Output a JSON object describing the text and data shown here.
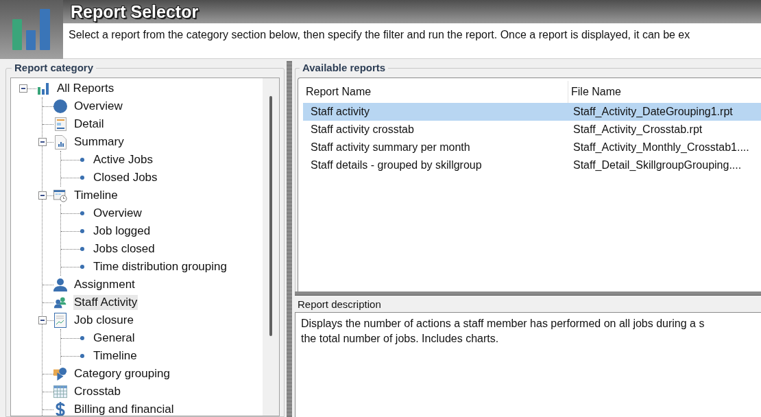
{
  "header": {
    "title": "Report Selector",
    "subtitle": "Select a report from the category section below, then specify the filter and run the report.  Once a report is displayed, it can be ex"
  },
  "category_panel": {
    "label": "Report category",
    "tree": [
      {
        "label": "All Reports",
        "kind": "all",
        "selected": false,
        "expanded": true,
        "children": [
          {
            "label": "Overview",
            "kind": "overview",
            "selected": false
          },
          {
            "label": "Detail",
            "kind": "detail",
            "selected": false
          },
          {
            "label": "Summary",
            "kind": "summary",
            "selected": false,
            "expanded": true,
            "children": [
              {
                "label": "Active Jobs",
                "kind": "leaf",
                "selected": false
              },
              {
                "label": "Closed Jobs",
                "kind": "leaf",
                "selected": false
              }
            ]
          },
          {
            "label": "Timeline",
            "kind": "timeline",
            "selected": false,
            "expanded": true,
            "children": [
              {
                "label": "Overview",
                "kind": "leaf",
                "selected": false
              },
              {
                "label": "Job logged",
                "kind": "leaf",
                "selected": false
              },
              {
                "label": "Jobs closed",
                "kind": "leaf",
                "selected": false
              },
              {
                "label": "Time distribution grouping",
                "kind": "leaf",
                "selected": false
              }
            ]
          },
          {
            "label": "Assignment",
            "kind": "assignment",
            "selected": false
          },
          {
            "label": "Staff Activity",
            "kind": "staff",
            "selected": true
          },
          {
            "label": "Job closure",
            "kind": "closure",
            "selected": false,
            "expanded": true,
            "children": [
              {
                "label": "General",
                "kind": "leaf",
                "selected": false
              },
              {
                "label": "Timeline",
                "kind": "leaf",
                "selected": false
              }
            ]
          },
          {
            "label": "Category grouping",
            "kind": "category",
            "selected": false
          },
          {
            "label": "Crosstab",
            "kind": "crosstab",
            "selected": false
          },
          {
            "label": "Billing and financial",
            "kind": "billing",
            "selected": false
          }
        ]
      }
    ]
  },
  "reports_panel": {
    "label": "Available reports",
    "columns": [
      "Report Name",
      "File Name"
    ],
    "rows": [
      {
        "report_name": "Staff activity",
        "file_name": "Staff_Activity_DateGrouping1.rpt",
        "selected": true
      },
      {
        "report_name": "Staff activity crosstab",
        "file_name": "Staff_Activity_Crosstab.rpt",
        "selected": false
      },
      {
        "report_name": "Staff activity summary per month",
        "file_name": "Staff_Activity_Monthly_Crosstab1....",
        "selected": false
      },
      {
        "report_name": "Staff details - grouped by skillgroup",
        "file_name": "Staff_Detail_SkillgroupGrouping....",
        "selected": false
      }
    ]
  },
  "description_panel": {
    "label": "Report description",
    "lines": [
      "Displays the number of actions a staff member has performed on all jobs during a s",
      "the total number of jobs. Includes charts."
    ]
  }
}
